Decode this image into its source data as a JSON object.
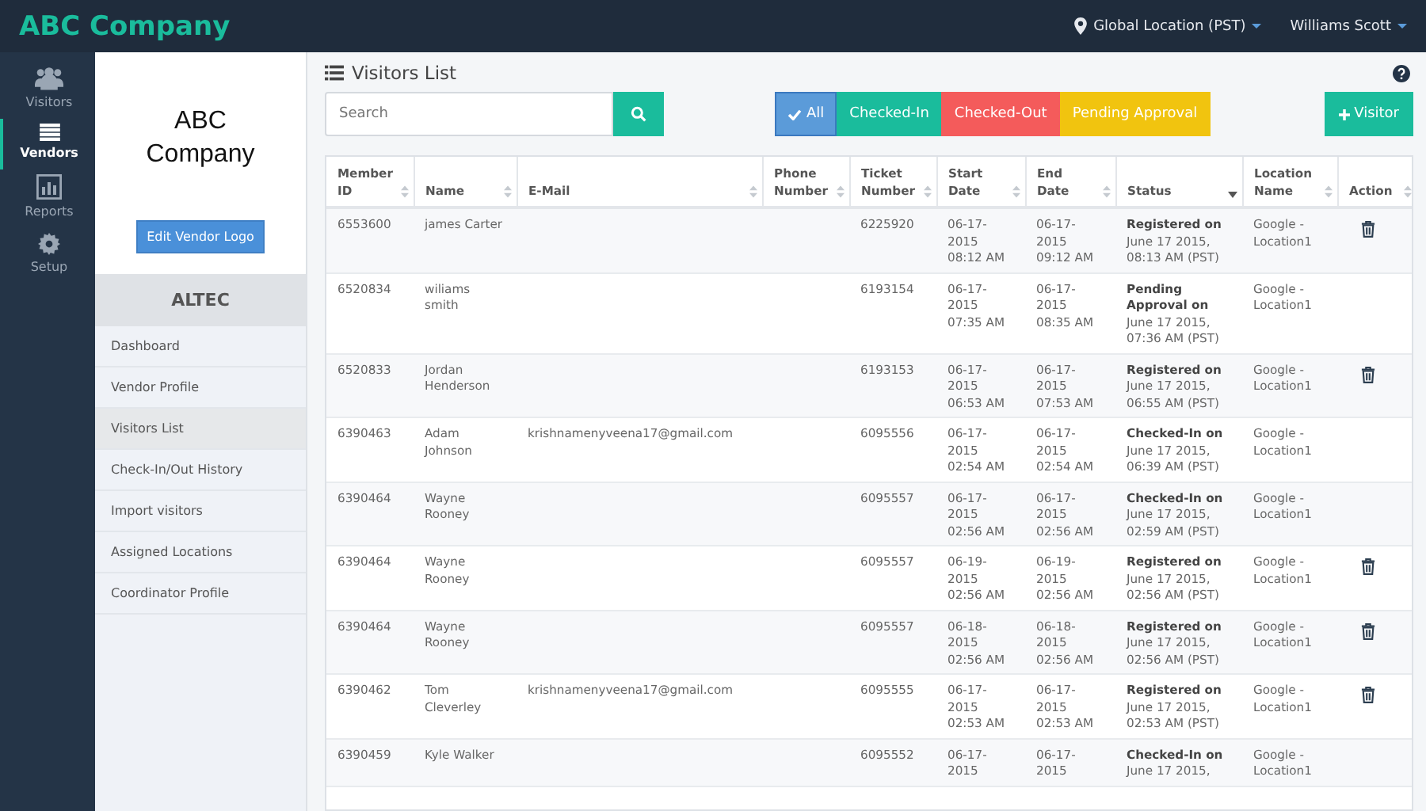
{
  "brand": "ABC Company",
  "topbar": {
    "location": "Global Location (PST)",
    "user": "Williams Scott"
  },
  "rail": [
    {
      "label": "Visitors",
      "selected": false
    },
    {
      "label": "Vendors",
      "selected": true
    },
    {
      "label": "Reports",
      "selected": false
    },
    {
      "label": "Setup",
      "selected": false
    }
  ],
  "vendor": {
    "logo_text": "ABC Company",
    "edit_button": "Edit Vendor Logo",
    "name": "ALTEC",
    "menu": [
      {
        "label": "Dashboard",
        "selected": false
      },
      {
        "label": "Vendor Profile",
        "selected": false
      },
      {
        "label": "Visitors List",
        "selected": true
      },
      {
        "label": "Check-In/Out History",
        "selected": false
      },
      {
        "label": "Import visitors",
        "selected": false
      },
      {
        "label": "Assigned Locations",
        "selected": false
      },
      {
        "label": "Coordinator Profile",
        "selected": false
      }
    ]
  },
  "page_title": "Visitors List",
  "search": {
    "placeholder": "Search"
  },
  "filters": [
    {
      "label": "All",
      "selected": true,
      "color": "#5b9bd9"
    },
    {
      "label": "Checked-In",
      "selected": false,
      "color": "#1abc9c"
    },
    {
      "label": "Checked-Out",
      "selected": false,
      "color": "#f45b5b"
    },
    {
      "label": "Pending Approval",
      "selected": false,
      "color": "#f1c40f"
    }
  ],
  "add_button": "Visitor",
  "table": {
    "columns": [
      {
        "label": "Member ID",
        "kind": "sortable"
      },
      {
        "label": "Name",
        "kind": "sortable"
      },
      {
        "label": "E-Mail",
        "kind": "sortable"
      },
      {
        "label": "Phone Number",
        "kind": "sortable"
      },
      {
        "label": "Ticket Number",
        "kind": "sortable"
      },
      {
        "label": "Start Date",
        "kind": "sortable"
      },
      {
        "label": "End Date",
        "kind": "sortable"
      },
      {
        "label": "Status",
        "kind": "sorted"
      },
      {
        "label": "Location Name",
        "kind": "sortable"
      },
      {
        "label": "Action",
        "kind": "sortable"
      }
    ],
    "rows": [
      {
        "member_id": "6553600",
        "name": "james Carter",
        "ticket": "6225920",
        "start": "06-17-2015 08:12 AM",
        "end": "06-17-2015 09:12 AM",
        "status": "**Registered on** June 17 2015, 08:13 AM (PST)",
        "location": "Google - Location1",
        "deletable": true
      },
      {
        "member_id": "6520834",
        "name": "wiliams smith",
        "ticket": "6193154",
        "start": "06-17-2015 07:35 AM",
        "end": "06-17-2015 08:35 AM",
        "status": "**Pending Approval on** June 17 2015, 07:36 AM (PST)",
        "location": "Google - Location1",
        "deletable": false
      },
      {
        "member_id": "6520833",
        "name": "Jordan Henderson",
        "ticket": "6193153",
        "start": "06-17-2015 06:53 AM",
        "end": "06-17-2015 07:53 AM",
        "status": "**Registered on** June 17 2015, 06:55 AM (PST)",
        "location": "Google - Location1",
        "deletable": true
      },
      {
        "member_id": "6390463",
        "name": "Adam Johnson",
        "email": "krishnamenyveena17@gmail.com",
        "ticket": "6095556",
        "start": "06-17-2015 02:54 AM",
        "end": "06-17-2015 02:54 AM",
        "status": "**Checked-In on** June 17 2015, 06:39 AM (PST)",
        "location": "Google - Location1",
        "deletable": false
      },
      {
        "member_id": "6390464",
        "name": "Wayne Rooney",
        "ticket": "6095557",
        "start": "06-17-2015 02:56 AM",
        "end": "06-17-2015 02:56 AM",
        "status": "**Checked-In on** June 17 2015, 02:59 AM (PST)",
        "location": "Google - Location1",
        "deletable": false
      },
      {
        "member_id": "6390464",
        "name": "Wayne Rooney",
        "ticket": "6095557",
        "start": "06-19-2015 02:56 AM",
        "end": "06-19-2015 02:56 AM",
        "status": "**Registered on** June 17 2015, 02:56 AM (PST)",
        "location": "Google - Location1",
        "deletable": true
      },
      {
        "member_id": "6390464",
        "name": "Wayne Rooney",
        "ticket": "6095557",
        "start": "06-18-2015 02:56 AM",
        "end": "06-18-2015 02:56 AM",
        "status": "**Registered on** June 17 2015, 02:56 AM (PST)",
        "location": "Google - Location1",
        "deletable": true
      },
      {
        "member_id": "6390462",
        "name": "Tom Cleverley",
        "email": "krishnamenyveena17@gmail.com",
        "ticket": "6095555",
        "start": "06-17-2015 02:53 AM",
        "end": "06-17-2015 02:53 AM",
        "status": "**Registered on** June 17 2015, 02:53 AM (PST)",
        "location": "Google - Location1",
        "deletable": true
      },
      {
        "member_id": "6390459",
        "name": "Kyle Walker",
        "ticket": "6095552",
        "start": "06-17-2015",
        "end": "06-17-2015",
        "status": "**Checked-In on** June 17 2015,",
        "location": "Google - Location1",
        "deletable": false
      }
    ]
  }
}
